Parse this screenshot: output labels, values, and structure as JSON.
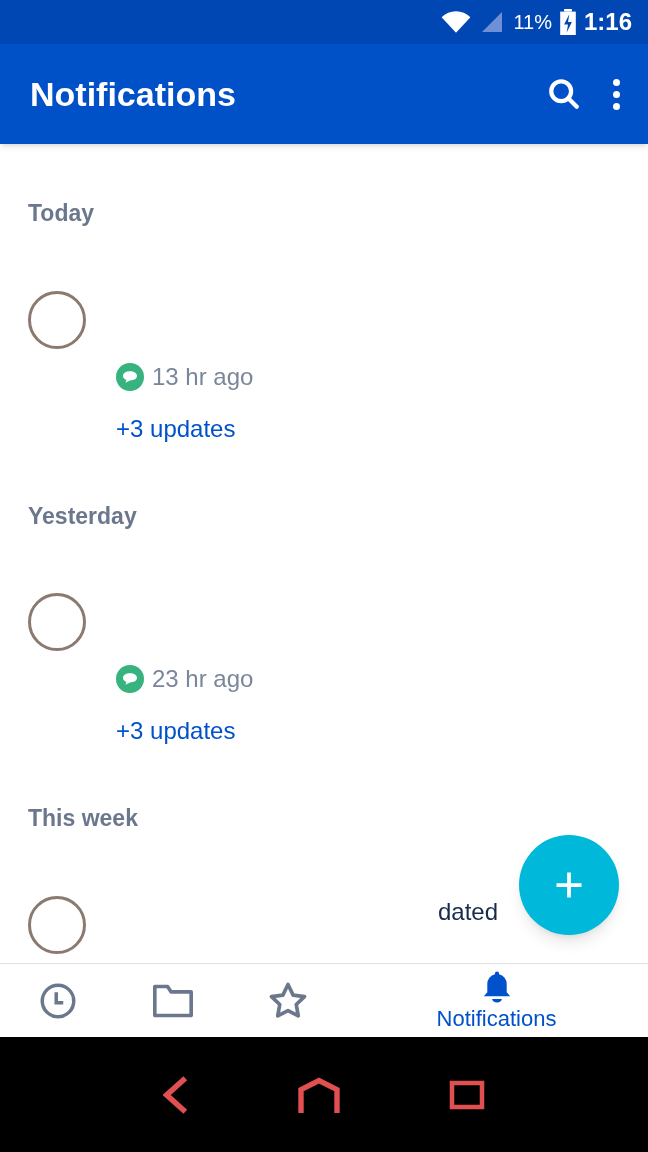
{
  "status_bar": {
    "battery": "11%",
    "time": "1:16"
  },
  "app_bar": {
    "title": "Notifications"
  },
  "sections": [
    {
      "title": "Today",
      "items": [
        {
          "time": "13 hr ago",
          "updates": "+3 updates"
        }
      ]
    },
    {
      "title": "Yesterday",
      "items": [
        {
          "time": "23 hr ago",
          "updates": "+3 updates"
        }
      ]
    },
    {
      "title": "This week",
      "items": [
        {
          "partial_text": "dated"
        }
      ]
    }
  ],
  "bottom_nav": [
    {
      "kind": "recent",
      "selected": false
    },
    {
      "kind": "files",
      "selected": false
    },
    {
      "kind": "starred",
      "selected": false
    },
    {
      "kind": "notifications",
      "label": "Notifications",
      "selected": true
    }
  ]
}
